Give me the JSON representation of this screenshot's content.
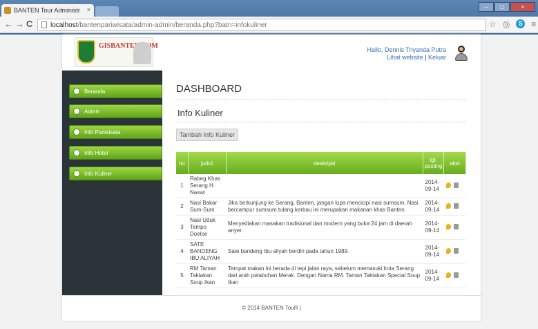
{
  "browser": {
    "tab_title": "BANTEN Tour Administr",
    "url_host": "localhost",
    "url_path": "/bantenpariwisata/admin-admin/beranda.php?batn=infokuliner"
  },
  "header": {
    "logo_text": "GISBANTEN.COM",
    "greeting": "Hallo, Dennis Triyanda Putra",
    "view_website": "Lihat website",
    "separator": "|",
    "logout": "Keluar"
  },
  "sidebar": {
    "items": [
      {
        "label": "Beranda"
      },
      {
        "label": "Admin"
      },
      {
        "label": "Info Pariwisata"
      },
      {
        "label": "Info Hotel"
      },
      {
        "label": "Info Kuliner"
      }
    ]
  },
  "main": {
    "dashboard_title": "DASHBOARD",
    "section_title": "Info Kuliner",
    "add_button": "Tambah Info Kuliner",
    "table": {
      "headers": [
        "no",
        "judul",
        "deskripsi",
        "tgl. posting",
        "aksi"
      ],
      "rows": [
        {
          "no": "1",
          "judul": "Rabeg Khas Serang H. Naswi",
          "deskripsi": "",
          "tgl": "2014-09-14"
        },
        {
          "no": "2",
          "judul": "Nasi Bakar Sum-Sum",
          "deskripsi": "Jika berkunjung ke Serang, Banten, jangan lupa mencicipi nasi sumsum. Nasi bercampur sumsum tulang kerbau ini merupakan makanan khas Banten.",
          "tgl": "2014-09-14"
        },
        {
          "no": "3",
          "judul": "Nasi Uduk Tempo Doeloe",
          "deskripsi": "Menyediakan masakan tradisional dan modern yang buka 24 jam di daerah anyer.",
          "tgl": "2014-09-14"
        },
        {
          "no": "4",
          "judul": "SATE BANDENG IBU ALIYAH",
          "deskripsi": "Sate bandeng Ibu aliyah berdiri pada tahun 1989.",
          "tgl": "2014-09-14"
        },
        {
          "no": "5",
          "judul": "RM Taman Taktakan Soup Ikan",
          "deskripsi": "Tempat makan ini berada di tepi jalan raya, sebelum memasuki kota Serang dari arah pelabuhan Merak. Dengan Nama RM. Taman Taktakan Special Soup Ikan",
          "tgl": "2014-09-14"
        }
      ]
    }
  },
  "footer": {
    "text": "© 2014 BANTEN TouR |"
  }
}
